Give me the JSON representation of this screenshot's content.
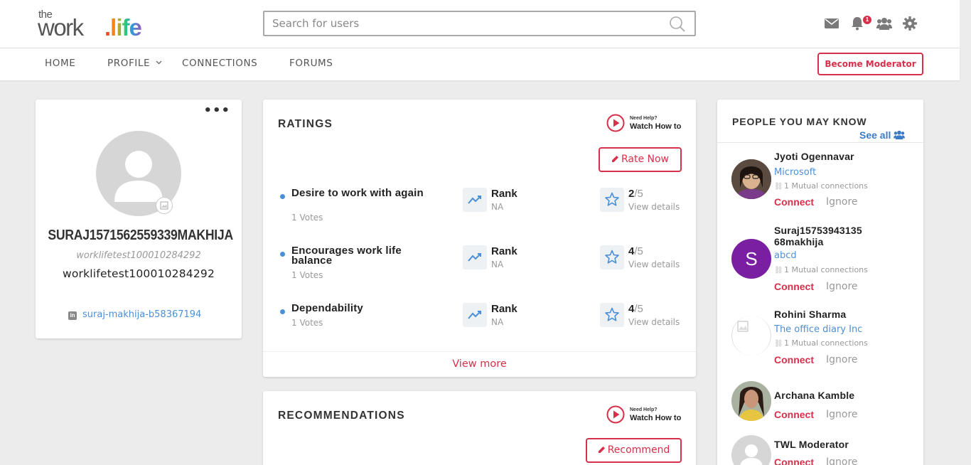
{
  "brand": {
    "the": "the",
    "work": "work",
    "life": ".life"
  },
  "search": {
    "placeholder": "Search for users"
  },
  "header": {
    "notification_count": "1"
  },
  "nav": {
    "home": "HOME",
    "profile": "PROFILE",
    "connections": "CONNECTIONS",
    "forums": "FORUMS",
    "moderator_button": "Become Moderator"
  },
  "profile": {
    "more": "•••",
    "name": "SURAJ1571562559339MAKHIJA",
    "subtitle": "worklifetest100010284292",
    "handle": "worklifetest100010284292",
    "linkedin_icon": "in",
    "linkedin": "suraj-makhija-b58367194"
  },
  "ratings": {
    "title": "RATINGS",
    "help_need": "Need Help?",
    "help_watch": "Watch How to",
    "rate_now": "Rate Now",
    "rows": [
      {
        "title": "Desire to work with again",
        "votes": "1 Votes",
        "rank": "Rank",
        "rank_value": "NA",
        "score": "2",
        "denom": "/5",
        "details": "View details"
      },
      {
        "title": "Encourages work life balance",
        "votes": "1 Votes",
        "rank": "Rank",
        "rank_value": "NA",
        "score": "4",
        "denom": "/5",
        "details": "View details"
      },
      {
        "title": "Dependability",
        "votes": "1 Votes",
        "rank": "Rank",
        "rank_value": "NA",
        "score": "4",
        "denom": "/5",
        "details": "View details"
      }
    ],
    "view_more": "View more"
  },
  "recommendations": {
    "title": "RECOMMENDATIONS",
    "help_need": "Need Help?",
    "help_watch": "Watch How to",
    "button": "Recommend"
  },
  "people": {
    "title": "PEOPLE YOU MAY KNOW",
    "see_all": "See all",
    "connect": "Connect",
    "ignore": "Ignore",
    "list": [
      {
        "name": "Jyoti Ogennavar",
        "company": "Microsoft",
        "mutual": "1 Mutual connections"
      },
      {
        "name": "Suraj15753943135 68makhija",
        "initial": "S",
        "company": "abcd",
        "mutual": "1 Mutual connections"
      },
      {
        "name": "Rohini Sharma",
        "company": "The office diary Inc",
        "mutual": "1 Mutual connections"
      },
      {
        "name": "Archana Kamble"
      },
      {
        "name": "TWL Moderator"
      }
    ]
  },
  "colors": {
    "accent": "#d6304a",
    "link": "#4a90d9",
    "avatar_purple": "#7b1fa2"
  }
}
